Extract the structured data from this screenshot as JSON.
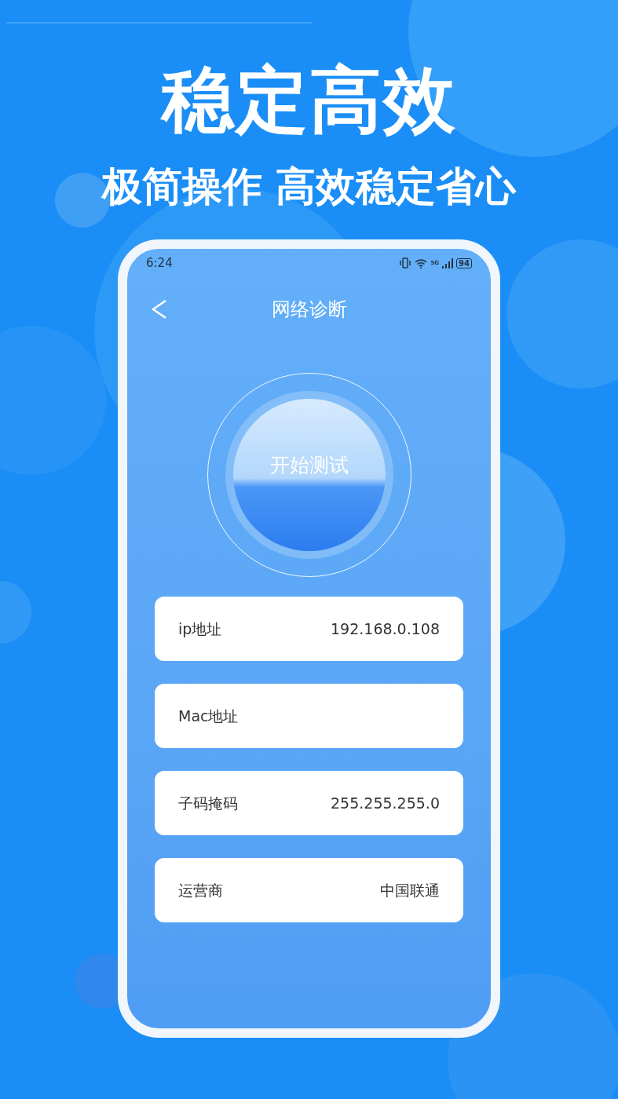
{
  "headline": "稳定高效",
  "subheadline": "极简操作 高效稳定省心",
  "phone": {
    "status_bar": {
      "time": "6:24",
      "network": "5G",
      "battery": "94"
    },
    "title": "网络诊断",
    "start_button": "开始测试",
    "info_rows": [
      {
        "label": "ip地址",
        "value": "192.168.0.108"
      },
      {
        "label": "Mac地址"
      },
      {
        "label": "子码掩码",
        "value": "255.255.255.0"
      },
      {
        "label": "运营商",
        "value": "中国联通"
      }
    ]
  }
}
